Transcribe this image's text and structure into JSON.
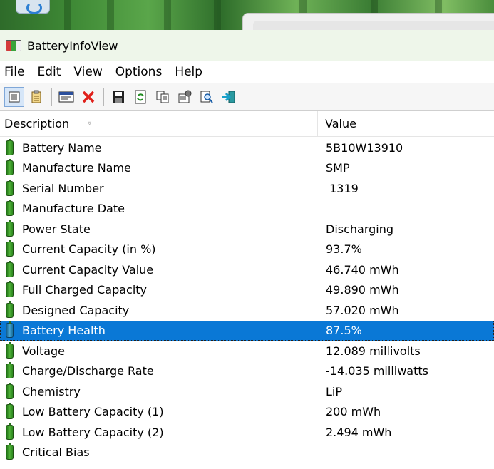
{
  "window": {
    "title": "BatteryInfoView"
  },
  "menu": [
    "File",
    "Edit",
    "View",
    "Options",
    "Help"
  ],
  "toolbar": [
    {
      "name": "view-list-icon",
      "pressed": true
    },
    {
      "name": "view-details-icon",
      "pressed": false
    },
    {
      "sep": true
    },
    {
      "name": "properties-window-icon",
      "pressed": false
    },
    {
      "name": "delete-icon",
      "pressed": false
    },
    {
      "sep": true
    },
    {
      "name": "save-icon",
      "pressed": false
    },
    {
      "name": "refresh-icon",
      "pressed": false
    },
    {
      "name": "copy-icon",
      "pressed": false
    },
    {
      "name": "properties-icon",
      "pressed": false
    },
    {
      "name": "find-icon",
      "pressed": false
    },
    {
      "name": "exit-icon",
      "pressed": false
    }
  ],
  "columns": {
    "description": "Description",
    "value": "Value"
  },
  "rows": [
    {
      "description": "Battery Name",
      "value": "5B10W13910"
    },
    {
      "description": "Manufacture Name",
      "value": "SMP"
    },
    {
      "description": "Serial Number",
      "value": " 1319"
    },
    {
      "description": "Manufacture Date",
      "value": ""
    },
    {
      "description": "Power State",
      "value": "Discharging"
    },
    {
      "description": "Current Capacity (in %)",
      "value": "93.7%"
    },
    {
      "description": "Current Capacity Value",
      "value": "46.740 mWh"
    },
    {
      "description": "Full Charged Capacity",
      "value": "49.890 mWh"
    },
    {
      "description": "Designed Capacity",
      "value": "57.020 mWh"
    },
    {
      "description": "Battery Health",
      "value": "87.5%",
      "selected": true
    },
    {
      "description": "Voltage",
      "value": "12.089 millivolts"
    },
    {
      "description": "Charge/Discharge Rate",
      "value": "-14.035 milliwatts"
    },
    {
      "description": "Chemistry",
      "value": "LiP"
    },
    {
      "description": "Low Battery Capacity (1)",
      "value": "200 mWh"
    },
    {
      "description": "Low Battery Capacity (2)",
      "value": "2.494 mWh"
    },
    {
      "description": "Critical Bias",
      "value": ""
    }
  ],
  "colors": {
    "selection": "#0a78d6",
    "titlebar": "#eef6ea"
  }
}
